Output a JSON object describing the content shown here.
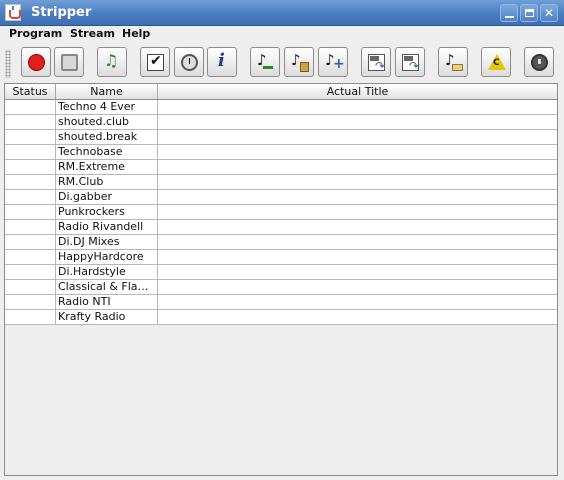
{
  "window": {
    "title": "Stripper"
  },
  "menu": [
    "Program",
    "Stream",
    "Help"
  ],
  "toolbar": {
    "buttons": [
      {
        "name": "record-icon"
      },
      {
        "name": "stop-icon"
      },
      {
        "name": "music-note-icon"
      },
      {
        "name": "checkbox-icon"
      },
      {
        "name": "clock-icon"
      },
      {
        "name": "info-icon"
      },
      {
        "name": "remove-stream-icon"
      },
      {
        "name": "edit-stream-icon"
      },
      {
        "name": "add-stream-icon"
      },
      {
        "name": "import-icon"
      },
      {
        "name": "export-icon"
      },
      {
        "name": "stream-folder-icon"
      },
      {
        "name": "warning-icon"
      },
      {
        "name": "power-icon"
      }
    ]
  },
  "table": {
    "columns": [
      "Status",
      "Name",
      "Actual Title"
    ],
    "rows": [
      {
        "status": "",
        "name": "Techno 4 Ever",
        "title": ""
      },
      {
        "status": "",
        "name": "shouted.club",
        "title": ""
      },
      {
        "status": "",
        "name": "shouted.break",
        "title": ""
      },
      {
        "status": "",
        "name": "Technobase",
        "title": ""
      },
      {
        "status": "",
        "name": "RM.Extreme",
        "title": ""
      },
      {
        "status": "",
        "name": "RM.Club",
        "title": ""
      },
      {
        "status": "",
        "name": "Di.gabber",
        "title": ""
      },
      {
        "status": "",
        "name": "Punkrockers",
        "title": ""
      },
      {
        "status": "",
        "name": "Radio Rivandell",
        "title": ""
      },
      {
        "status": "",
        "name": "Di.DJ Mixes",
        "title": ""
      },
      {
        "status": "",
        "name": "HappyHardcore",
        "title": ""
      },
      {
        "status": "",
        "name": "Di.Hardstyle",
        "title": ""
      },
      {
        "status": "",
        "name": "Classical & Flamenco",
        "title": ""
      },
      {
        "status": "",
        "name": "Radio NTI",
        "title": ""
      },
      {
        "status": "",
        "name": "Krafty Radio",
        "title": ""
      }
    ]
  }
}
